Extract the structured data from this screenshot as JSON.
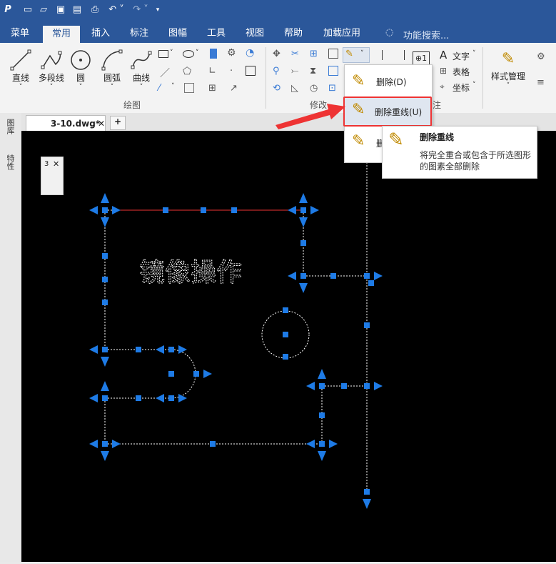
{
  "menubar": {
    "tabs": [
      "菜单",
      "常用",
      "插入",
      "标注",
      "图幅",
      "工具",
      "视图",
      "帮助",
      "加载应用"
    ],
    "active_tab": "常用",
    "search_placeholder": "功能搜索..."
  },
  "ribbon": {
    "draw_tools": [
      "直线",
      "多段线",
      "圆",
      "圆弧",
      "曲线"
    ],
    "draw_group_label": "绘图",
    "modify_group_label": "修改",
    "annotation_items": [
      "文字",
      "表格",
      "坐标"
    ],
    "annotation_group_tail": "注",
    "style_manager_label": "样式管理"
  },
  "dropdown": {
    "delete_label": "删除(D)",
    "dedup_label": "删除重线(U)",
    "third_label_partial": "删"
  },
  "tooltip": {
    "title": "删除重线",
    "description": "将完全重合或包含于所选图形的图素全部删除"
  },
  "doc_tab": {
    "name": "3-10.dwg*"
  },
  "side_panel": {
    "tabs": [
      "图库",
      "特性"
    ]
  },
  "float_box": {
    "label": "3"
  },
  "canvas": {
    "drawing_text": "镜像操作"
  },
  "colors": {
    "accent": "#2b579a",
    "grip": "#1e7be6",
    "highlight": "#e33333"
  }
}
